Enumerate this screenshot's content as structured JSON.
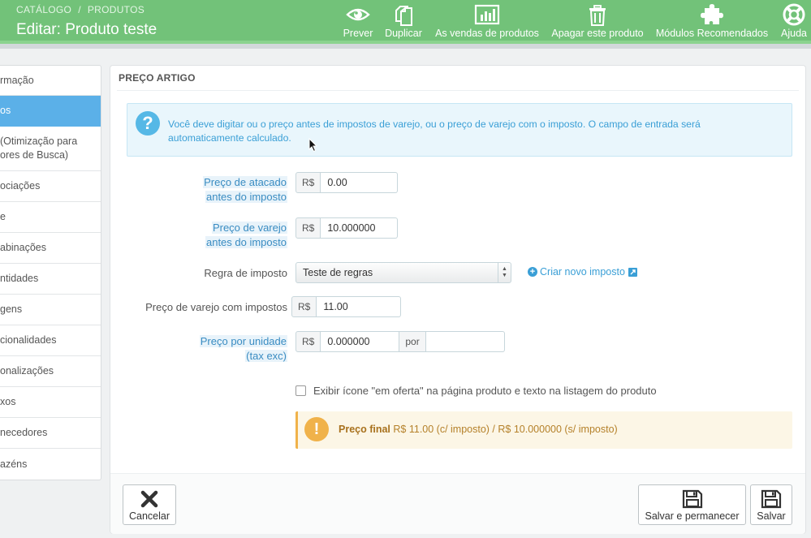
{
  "header": {
    "breadcrumb": [
      "CATÁLOGO",
      "PRODUTOS"
    ],
    "breadcrumb_sep": "/",
    "title": "Editar: Produto teste",
    "toolbar": [
      {
        "label": "Prever",
        "icon": "eye-icon"
      },
      {
        "label": "Duplicar",
        "icon": "copy-icon"
      },
      {
        "label": "As vendas de produtos",
        "icon": "bar-chart-icon"
      },
      {
        "label": "Apagar este produto",
        "icon": "trash-icon"
      },
      {
        "label": "Módulos Recomendados",
        "icon": "puzzle-icon"
      },
      {
        "label": "Ajuda",
        "icon": "lifebuoy-icon"
      }
    ]
  },
  "left_menu": {
    "items": [
      {
        "label": "rmação"
      },
      {
        "label": "os",
        "active": true
      },
      {
        "label": "(Otimização para\nores de Busca)"
      },
      {
        "label": "ociações"
      },
      {
        "label": "e"
      },
      {
        "label": "abinações"
      },
      {
        "label": "ntidades"
      },
      {
        "label": "gens"
      },
      {
        "label": "cionalidades"
      },
      {
        "label": "onalizações"
      },
      {
        "label": "xos"
      },
      {
        "label": "necedores"
      },
      {
        "label": "azéns"
      }
    ]
  },
  "panel": {
    "heading": "PREÇO ARTIGO",
    "info_text": "Você deve digitar ou o preço antes de impostos de varejo, ou o preço de varejo com o imposto. O campo de entrada será automaticamente calculado.",
    "fields": {
      "wholesale": {
        "label_line1": "Preço de atacado",
        "label_line2": "antes do imposto",
        "currency": "R$",
        "value": "0.00"
      },
      "retail": {
        "label_line1": "Preço de varejo",
        "label_line2": "antes do imposto",
        "currency": "R$",
        "value": "10.000000"
      },
      "tax_rule": {
        "label": "Regra de imposto",
        "selected": "Teste de regras",
        "new_tax_link": "Criar novo imposto"
      },
      "retail_with_tax": {
        "label": "Preço de varejo com impostos",
        "currency": "R$",
        "value": "11.00"
      },
      "unit_price": {
        "label_line1": "Preço por unidade",
        "label_line2": "(tax exc)",
        "currency": "R$",
        "value": "0.000000",
        "per_label": "por",
        "per_value": ""
      }
    },
    "on_sale_label": "Exibir ícone \"em oferta\" na página produto e texto na listagem do produto",
    "on_sale_checked": false,
    "final_price": {
      "label": "Preço final",
      "text": " R$ 11.00 (c/ imposto) / R$ 10.000000 (s/ imposto)"
    },
    "footer": {
      "cancel": "Cancelar",
      "save_stay": "Salvar e permanecer",
      "save": "Salvar"
    }
  }
}
